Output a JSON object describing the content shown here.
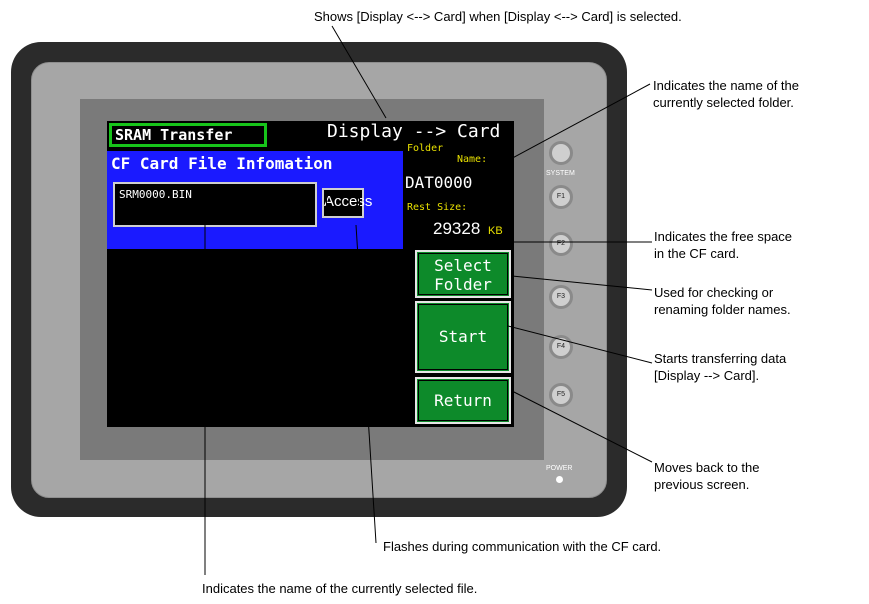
{
  "screen": {
    "title": "SRAM Transfer",
    "mode": "Display --> Card",
    "panel_title": "CF Card File Infomation",
    "file_name": "SRM0000.BIN",
    "access_label": "Access",
    "folder_label": "Folder",
    "name_label": "Name:",
    "folder_value": "DAT0000",
    "rest_label": "Rest Size:",
    "rest_value": "29328",
    "rest_unit": "KB",
    "buttons": {
      "select_folder_line1": "Select",
      "select_folder_line2": "Folder",
      "start": "Start",
      "return": "Return"
    }
  },
  "device": {
    "system_label": "SYSTEM",
    "fkeys": [
      "F1",
      "F2",
      "F3",
      "F4",
      "F5"
    ],
    "power_label": "POWER"
  },
  "callouts": {
    "mode_note": "Shows [Display <--> Card] when [Display <--> Card] is selected.",
    "folder_note_1": "Indicates the name of the",
    "folder_note_2": "currently selected folder.",
    "free_note_1": "Indicates the free space",
    "free_note_2": "in the CF card.",
    "select_note_1": "Used for checking or",
    "select_note_2": "renaming folder names.",
    "start_note_1": "Starts transferring data",
    "start_note_2": "[Display --> Card].",
    "return_note_1": "Moves back to the",
    "return_note_2": "previous screen.",
    "access_note": "Flashes during communication with the CF card.",
    "file_note": "Indicates the name of the currently selected file."
  },
  "colors": {
    "bezel": "#2b2b2b",
    "panel_gray": "#a6a6a6",
    "info_blue": "#1a1aff",
    "button_green": "#0d8a2a",
    "label_yellow": "#e8e000"
  }
}
